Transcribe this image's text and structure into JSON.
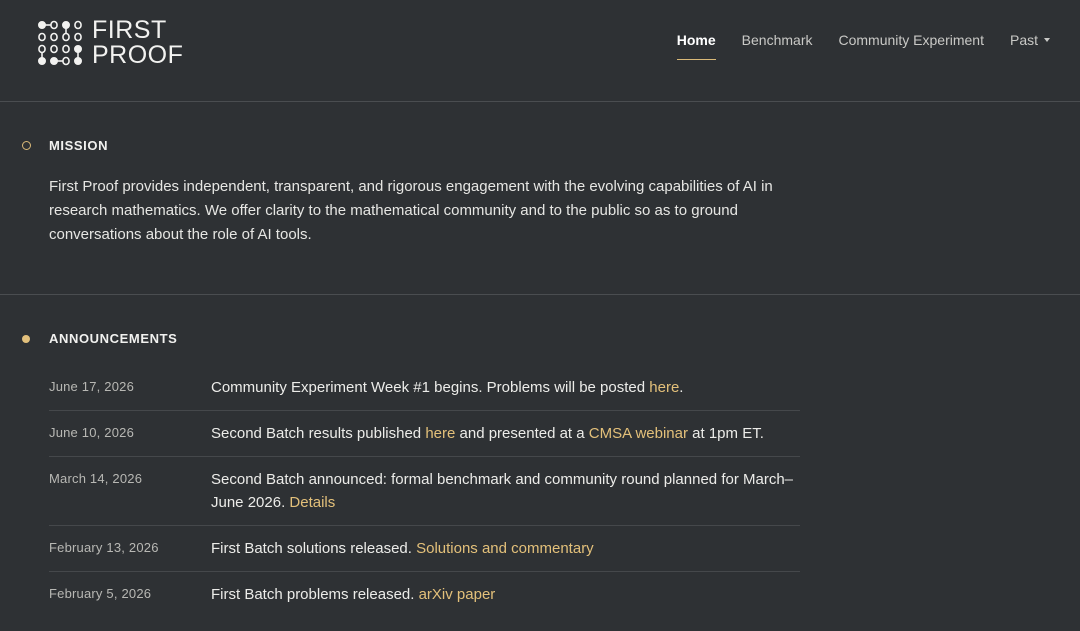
{
  "brand": {
    "line1": "FIRST",
    "line2": "PROOF",
    "accent": "#d9b978"
  },
  "nav": {
    "items": [
      {
        "label": "Home",
        "active": true
      },
      {
        "label": "Benchmark"
      },
      {
        "label": "Community Experiment"
      },
      {
        "label": "Past",
        "has_dropdown": true,
        "icon": "caret-down-icon"
      }
    ]
  },
  "mission": {
    "title": "MISSION",
    "body": "First Proof provides independent, transparent, and rigorous engagement with the evolving capabilities of AI in research mathematics. We offer clarity to the mathematical community and to the public so as to ground conversations about the role of AI tools."
  },
  "announcements": {
    "title": "ANNOUNCEMENTS",
    "items": [
      {
        "date": "June 17, 2026",
        "t1": "Community Experiment Week #1 begins. Problems will be posted ",
        "l1": "here",
        "t2": "."
      },
      {
        "date": "June 10, 2026",
        "t1": "Second Batch results published ",
        "l1": "here",
        "t2": " and presented at a ",
        "l2": "CMSA webinar",
        "t3": " at 1pm ET."
      },
      {
        "date": "March 14, 2026",
        "t1": "Second Batch announced: formal benchmark and community round planned for March–June 2026. ",
        "l1": "Details"
      },
      {
        "date": "February 13, 2026",
        "t1": "First Batch solutions released. ",
        "l1": "Solutions and commentary"
      },
      {
        "date": "February 5, 2026",
        "t1": "First Batch problems released. ",
        "l1": "arXiv paper"
      }
    ]
  }
}
